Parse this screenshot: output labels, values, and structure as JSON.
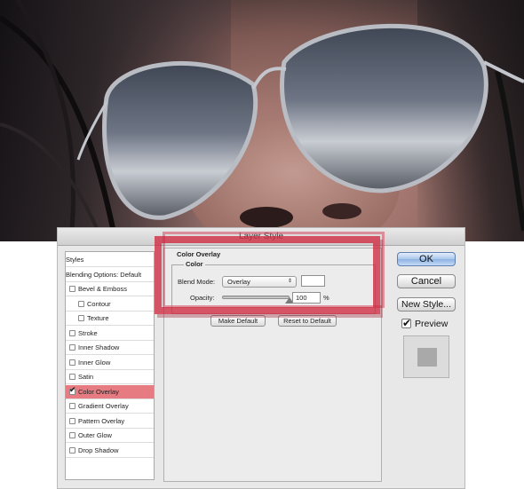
{
  "dialog": {
    "title": "Layer Style",
    "styles_panel": {
      "items": [
        {
          "label": "Styles",
          "has_checkbox": false,
          "checked": false,
          "indent": 0,
          "selected": false
        },
        {
          "label": "Blending Options: Default",
          "has_checkbox": false,
          "checked": false,
          "indent": 0,
          "selected": false
        },
        {
          "label": "Bevel & Emboss",
          "has_checkbox": true,
          "checked": false,
          "indent": 0,
          "selected": false
        },
        {
          "label": "Contour",
          "has_checkbox": true,
          "checked": false,
          "indent": 1,
          "selected": false
        },
        {
          "label": "Texture",
          "has_checkbox": true,
          "checked": false,
          "indent": 1,
          "selected": false
        },
        {
          "label": "Stroke",
          "has_checkbox": true,
          "checked": false,
          "indent": 0,
          "selected": false
        },
        {
          "label": "Inner Shadow",
          "has_checkbox": true,
          "checked": false,
          "indent": 0,
          "selected": false
        },
        {
          "label": "Inner Glow",
          "has_checkbox": true,
          "checked": false,
          "indent": 0,
          "selected": false
        },
        {
          "label": "Satin",
          "has_checkbox": true,
          "checked": false,
          "indent": 0,
          "selected": false
        },
        {
          "label": "Color Overlay",
          "has_checkbox": true,
          "checked": true,
          "indent": 0,
          "selected": true
        },
        {
          "label": "Gradient Overlay",
          "has_checkbox": true,
          "checked": false,
          "indent": 0,
          "selected": false
        },
        {
          "label": "Pattern Overlay",
          "has_checkbox": true,
          "checked": false,
          "indent": 0,
          "selected": false
        },
        {
          "label": "Outer Glow",
          "has_checkbox": true,
          "checked": false,
          "indent": 0,
          "selected": false
        },
        {
          "label": "Drop Shadow",
          "has_checkbox": true,
          "checked": false,
          "indent": 0,
          "selected": false
        }
      ]
    },
    "color_overlay": {
      "section_title": "Color Overlay",
      "group_title": "Color",
      "blend_mode_label": "Blend Mode:",
      "blend_mode_value": "Overlay",
      "overlay_color": "#ffffff",
      "opacity_label": "Opacity:",
      "opacity_value": "100",
      "opacity_unit": "%",
      "opacity_fraction": 1.0,
      "make_default_label": "Make Default",
      "reset_default_label": "Reset to Default"
    },
    "buttons": {
      "ok_label": "OK",
      "cancel_label": "Cancel",
      "new_style_label": "New Style..."
    },
    "preview": {
      "label": "Preview",
      "checked": true
    }
  },
  "colors": {
    "selected_row": "#e77b82",
    "highlight_annotation": "#ce2940"
  },
  "icons": {
    "checkmark": "checkmark-icon",
    "select_arrows": "updown-arrows-icon",
    "slider_thumb": "triangle-thumb-icon"
  }
}
